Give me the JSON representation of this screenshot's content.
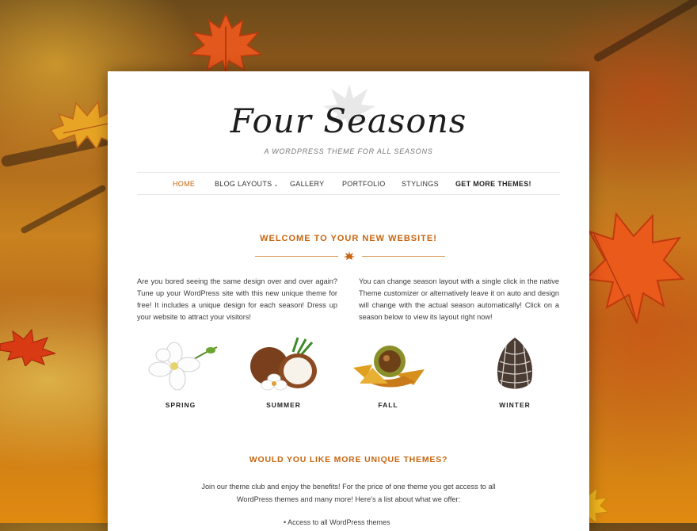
{
  "site": {
    "title": "Four Seasons",
    "tagline": "A WORDPRESS THEME FOR ALL SEASONS"
  },
  "nav": {
    "items": [
      {
        "label": "HOME",
        "active": true
      },
      {
        "label": "BLOG LAYOUTS",
        "has_dropdown": true
      },
      {
        "label": "GALLERY"
      },
      {
        "label": "PORTFOLIO"
      },
      {
        "label": "STYLINGS"
      },
      {
        "label": "GET MORE THEMES!",
        "bold": true
      }
    ]
  },
  "welcome": {
    "heading": "WELCOME TO YOUR NEW WEBSITE!",
    "left_text": "Are you bored seeing the same design over and over again? Tune up your WordPress site with this new unique theme for free! It includes a unique design for each season! Dress up your website to attract your visitors!",
    "right_text": "You can change season layout with a single click in the native Theme customizer or alternatively leave it on auto and design will change with the actual season automatically! Click on a season below to view its layout right now!"
  },
  "seasons": [
    {
      "label": "SPRING",
      "icon": "white-flower-icon"
    },
    {
      "label": "SUMMER",
      "icon": "coconut-icon"
    },
    {
      "label": "FALL",
      "icon": "chestnut-leaves-icon"
    },
    {
      "label": "WINTER",
      "icon": "pine-cone-icon"
    }
  ],
  "more": {
    "heading": "WOULD YOU LIKE MORE UNIQUE THEMES?",
    "text": "Join our theme club and enjoy the benefits! For the price of one theme you get access to all WordPress themes and many more! Here's a list about what we offer:",
    "list_first": "• Access to all WordPress themes"
  },
  "colors": {
    "accent": "#c8650f",
    "background_autumn": "#c9821f",
    "panel": "#ffffff"
  }
}
